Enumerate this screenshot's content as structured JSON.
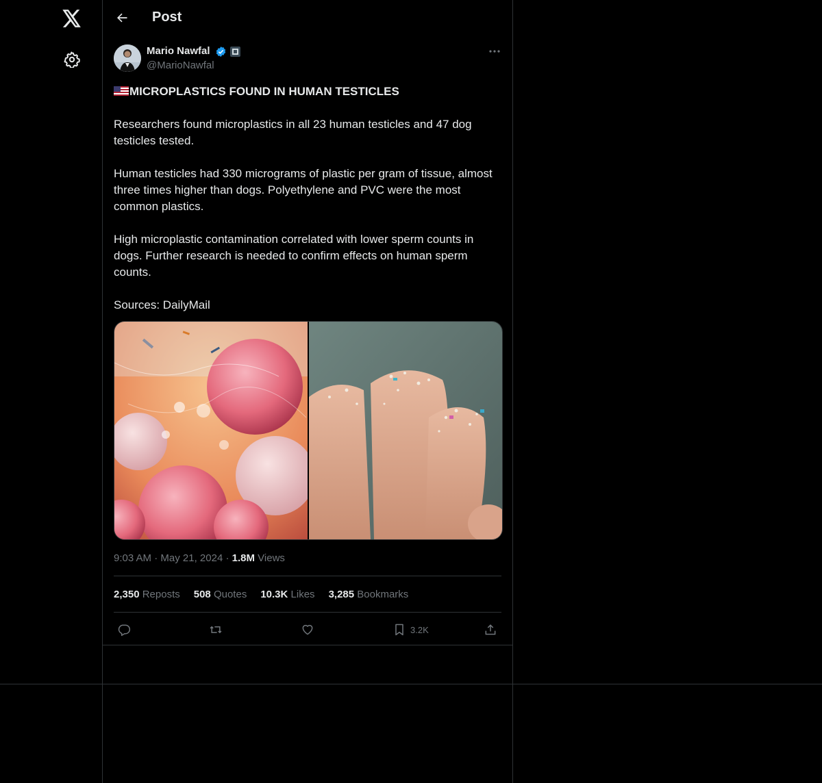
{
  "nav": {
    "items": [
      "x-logo",
      "settings"
    ]
  },
  "header": {
    "title": "Post"
  },
  "post": {
    "author": {
      "name": "Mario Nawfal",
      "handle": "@MarioNawfal"
    },
    "headline": "MICROPLASTICS FOUND IN HUMAN TESTICLES",
    "paragraphs": [
      "Researchers found microplastics in all 23 human testicles and 47 dog testicles tested.",
      "Human testicles had 330 micrograms of plastic per gram of tissue, almost three times higher than dogs. Polyethylene and PVC were the most common plastics.",
      "High microplastic contamination correlated with lower sperm counts in dogs. Further research is needed to confirm effects on human sperm counts.",
      "Sources: DailyMail"
    ],
    "meta": {
      "time": "9:03 AM",
      "date": "May 21, 2024",
      "views_count": "1.8M",
      "views_label": "Views"
    },
    "stats": {
      "reposts_count": "2,350",
      "reposts_label": "Reposts",
      "quotes_count": "508",
      "quotes_label": "Quotes",
      "likes_count": "10.3K",
      "likes_label": "Likes",
      "bookmarks_count": "3,285",
      "bookmarks_label": "Bookmarks"
    },
    "actions": {
      "bookmark_count": "3.2K"
    }
  },
  "colors": {
    "background": "#000000",
    "text": "#e7e9ea",
    "muted": "#71767b",
    "border": "#2f3336",
    "verified": "#1d9bf0"
  }
}
